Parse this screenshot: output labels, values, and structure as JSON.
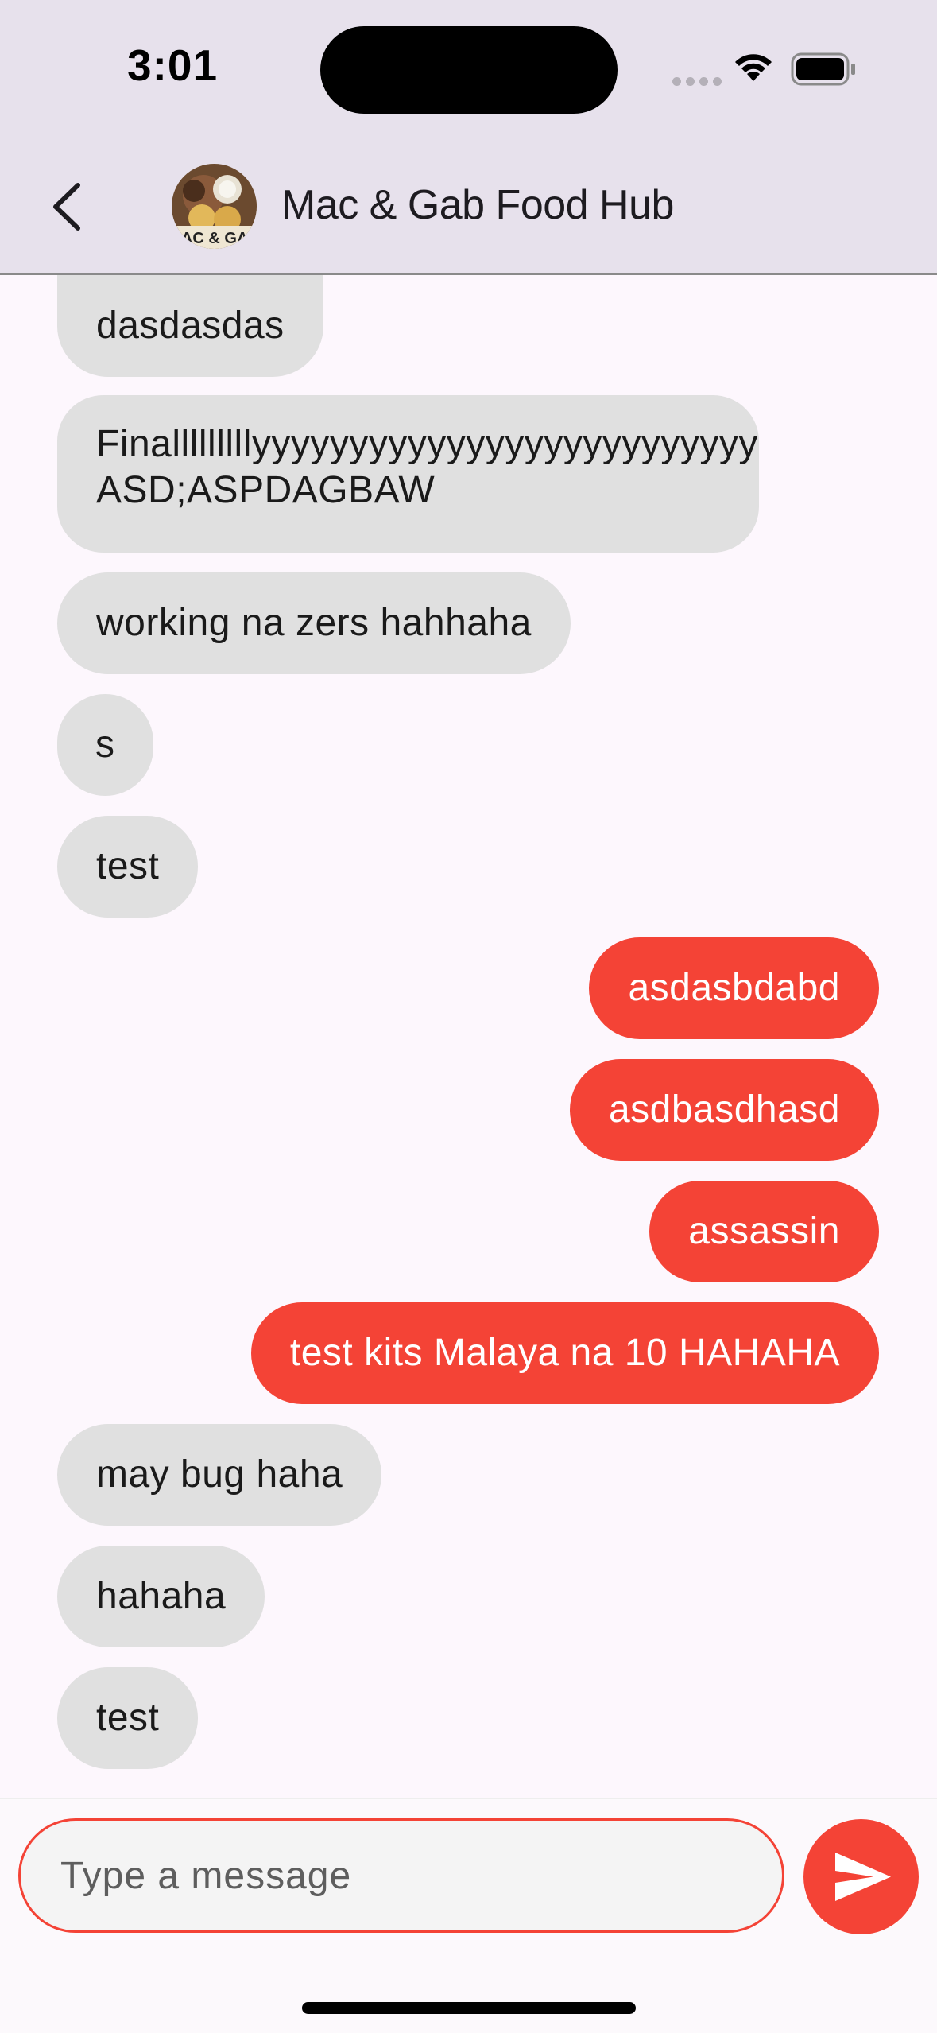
{
  "status_bar": {
    "time": "3:01"
  },
  "header": {
    "title": "Mac & Gab Food Hub",
    "avatar_text": "MAC & GAB"
  },
  "messages": [
    {
      "text": "dasdasdas",
      "from": "other"
    },
    {
      "text": "Finalllllllllyyyyyyyyyyyyyyyyyyyyyyyyyy ASD;ASPDAGBAW",
      "from": "other"
    },
    {
      "text": "working na zers hahhaha",
      "from": "other"
    },
    {
      "text": "s",
      "from": "other"
    },
    {
      "text": "test",
      "from": "other"
    },
    {
      "text": "asdasbdabd",
      "from": "me"
    },
    {
      "text": "asdbasdhasd",
      "from": "me"
    },
    {
      "text": "assassin",
      "from": "me"
    },
    {
      "text": "test kits Malaya na 10 HAHAHA",
      "from": "me"
    },
    {
      "text": "may bug haha",
      "from": "other"
    },
    {
      "text": "hahaha",
      "from": "other"
    },
    {
      "text": "test",
      "from": "other"
    }
  ],
  "composer": {
    "placeholder": "Type a message",
    "value": ""
  },
  "colors": {
    "accent": "#f44336",
    "incoming_bubble": "#e0e0e0",
    "header_bg": "#e7e1ec"
  }
}
